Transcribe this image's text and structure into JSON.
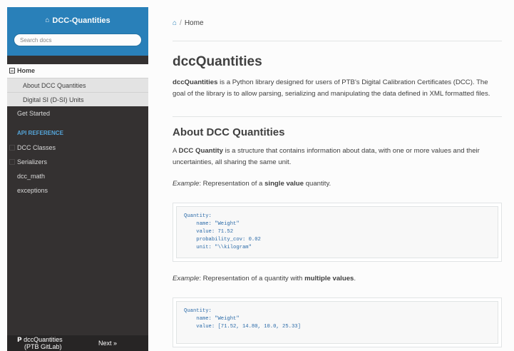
{
  "sidebar": {
    "project_title": "DCC-Quantities",
    "search_placeholder": "Search docs",
    "home_label": "Home",
    "home_children": [
      "About DCC Quantities",
      "Digital SI (D-SI) Units"
    ],
    "get_started": "Get Started",
    "caption": "API REFERENCE",
    "api_items": [
      "DCC Classes",
      "Serializers",
      "dcc_math",
      "exceptions"
    ],
    "repo_line1": "dccQuantities",
    "repo_line2": "(PTB GitLab)",
    "next_label": "Next »",
    "colors": {
      "sidebar_bg": "#343131",
      "header_bg": "#2980b9",
      "caption": "#55a5d9"
    }
  },
  "breadcrumb": {
    "home": "Home"
  },
  "main": {
    "title": "dccQuantities",
    "intro_strong": "dccQuantities",
    "intro_rest": " is a Python library designed for users of PTB's Digital Calibration Certificates (DCC). The goal of the library is to allow parsing, serializing and manipulating the data defined in XML formatted files.",
    "section_title": "About DCC Quantities",
    "about_pre": "A ",
    "about_strong": "DCC Quantity",
    "about_rest": " is a structure that contains information about data, with one or more values and their uncertainties, all sharing the same unit.",
    "example1_em": "Example",
    "example1_pre": ": Representation of a ",
    "example1_strong": "single value",
    "example1_post": " quantity.",
    "code1": "Quantity:\n    name: \"Weight\"\n    value: 71.52\n    probability_cov: 0.02\n    unit: \"\\\\kilogram\"",
    "example2_em": "Example",
    "example2_pre": ": Representation of a quantity with ",
    "example2_strong": "multiple values",
    "example2_post": ".",
    "code2": "Quantity:\n    name: \"Weight\"\n    value: [71.52, 14.80, 10.0, 25.33]"
  }
}
